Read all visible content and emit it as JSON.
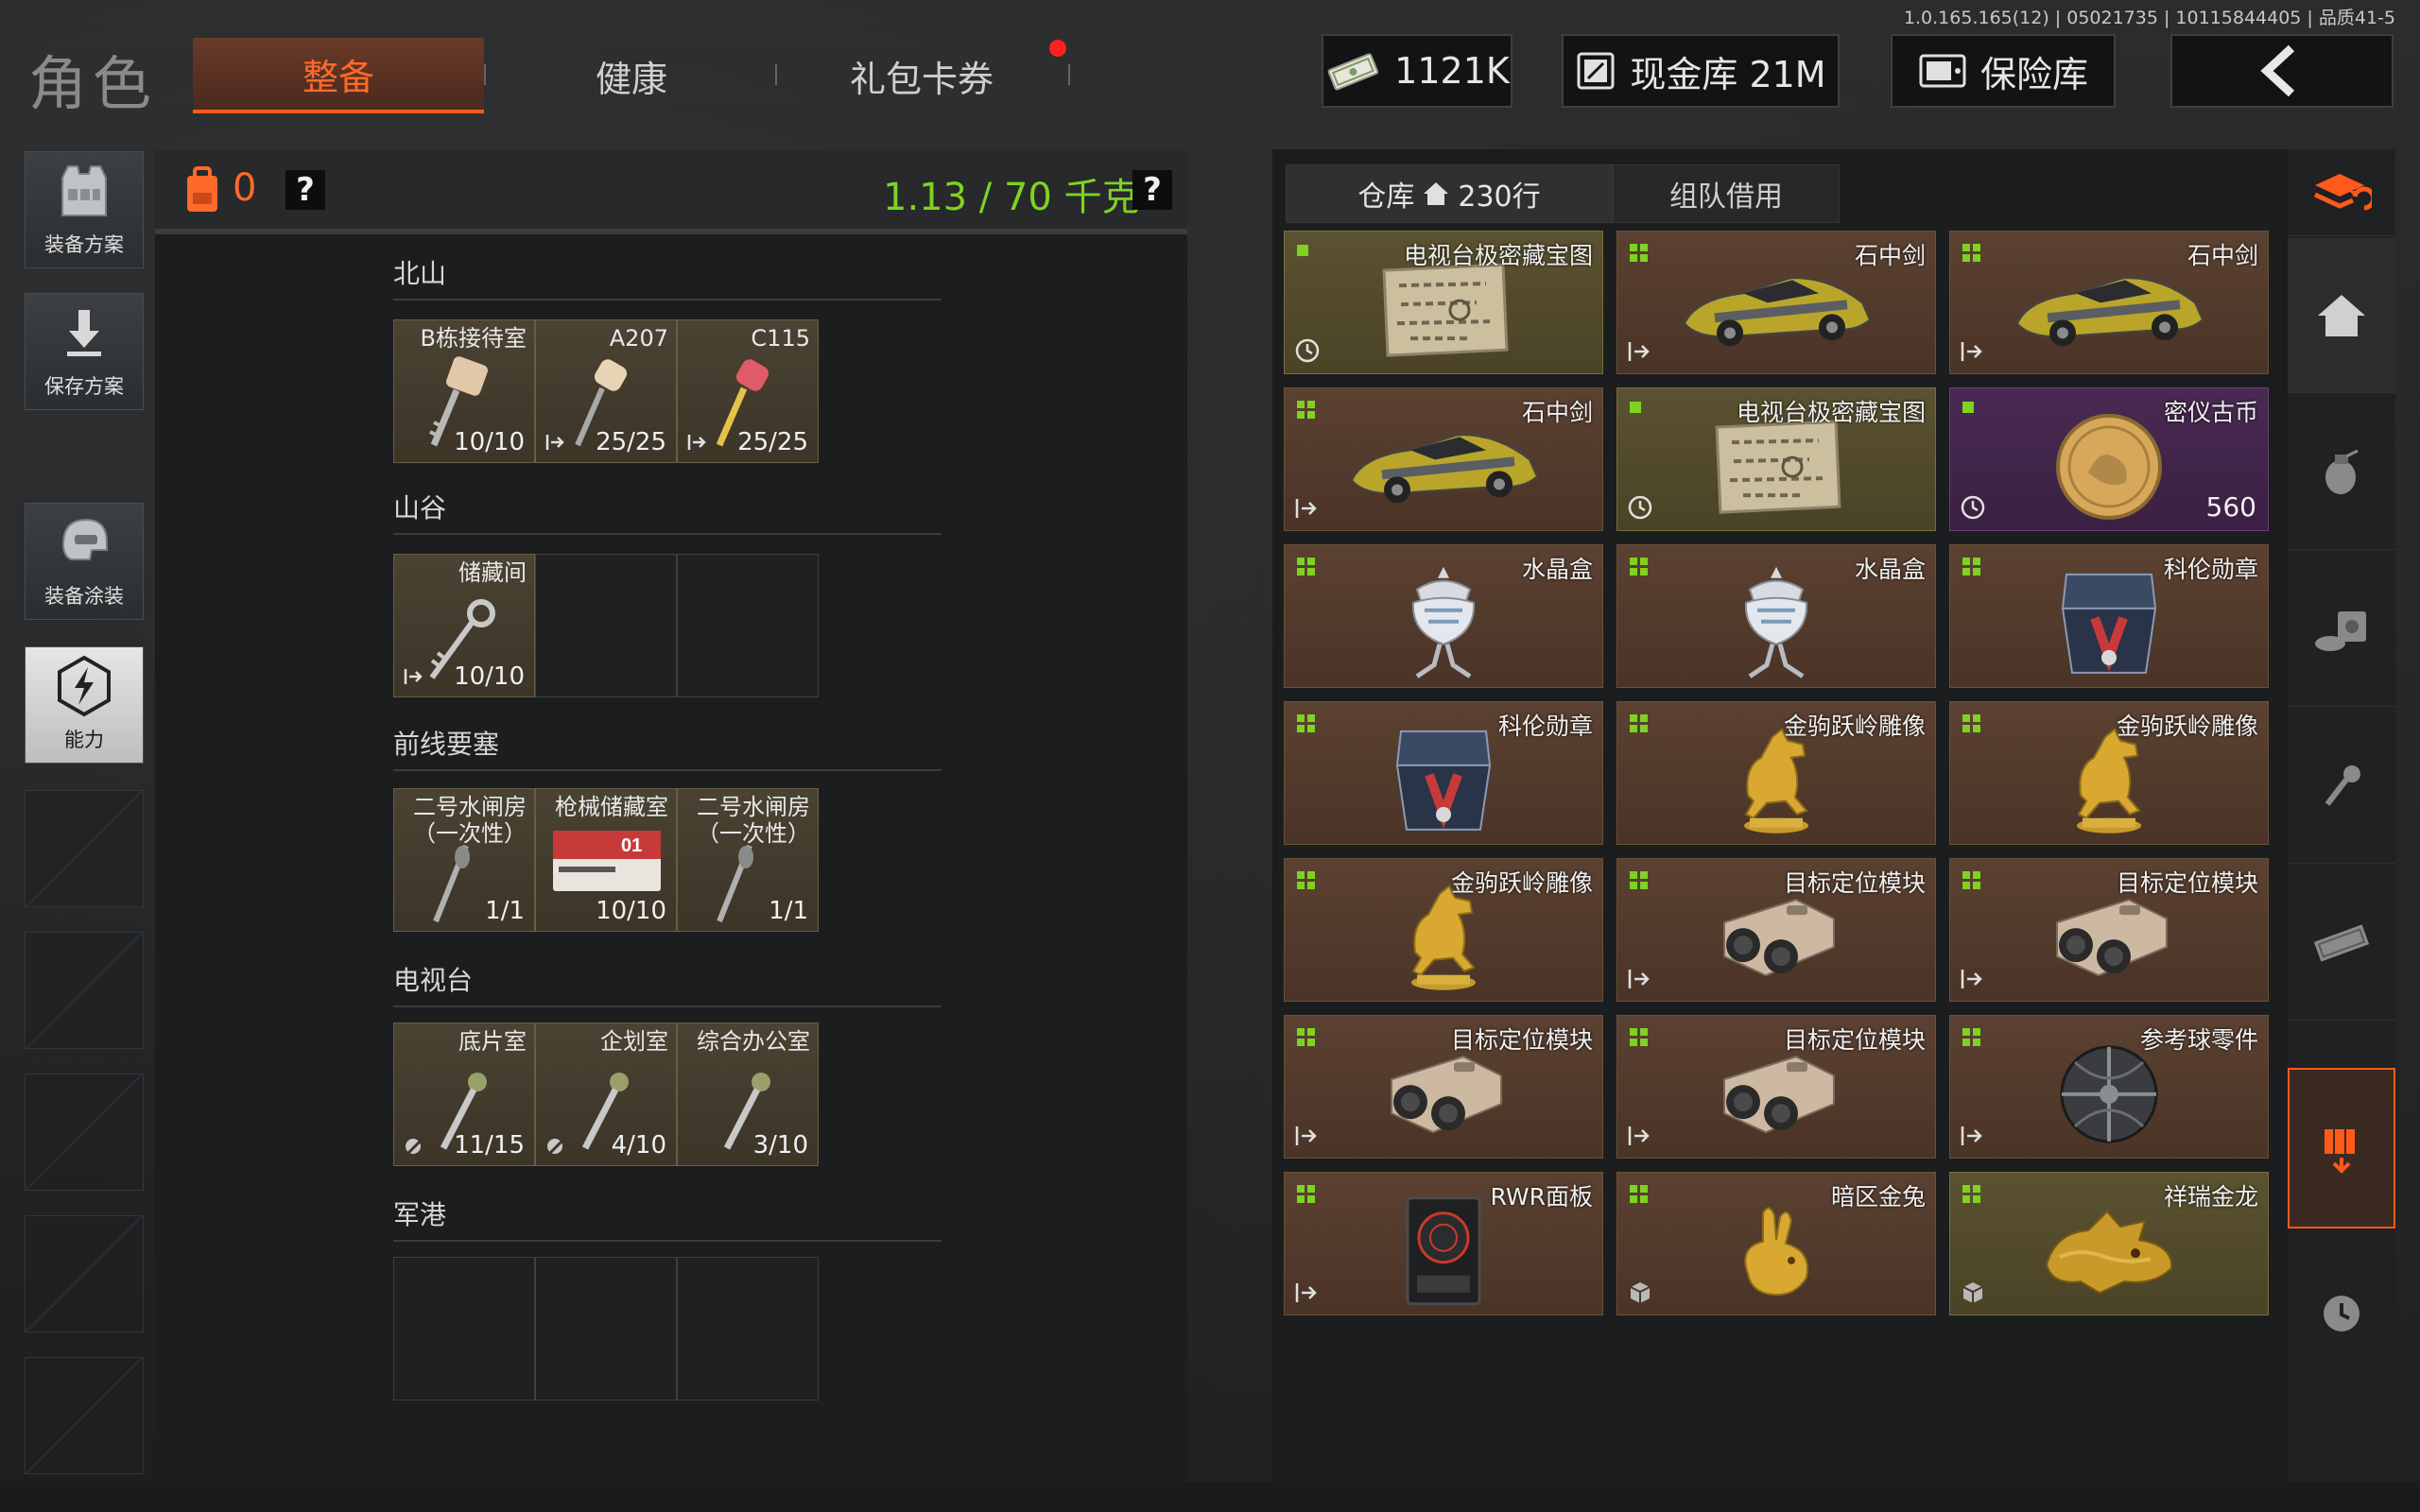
{
  "version": "1.0.165.165(12) | 05021735 | 10115844405 | 品质41-5",
  "header": {
    "title": "角色",
    "tabs": [
      {
        "label": "整备",
        "active": true
      },
      {
        "label": "健康",
        "active": false
      },
      {
        "label": "礼包卡券",
        "active": false,
        "notification": true
      }
    ],
    "currency": "1121K",
    "cash_vault": "现金库 21M",
    "safe": "保险库"
  },
  "sidebar": {
    "items": [
      {
        "label": "装备方案",
        "icon": "vest-icon"
      },
      {
        "label": "保存方案",
        "icon": "download-icon"
      },
      {
        "label": "装备涂装",
        "icon": "helmet-icon"
      },
      {
        "label": "能力",
        "icon": "ability-icon",
        "active": true
      }
    ]
  },
  "left_panel": {
    "bag_count": "0",
    "weight": "1.13 / 70 千克",
    "help": "?",
    "regions": [
      {
        "name": "北山",
        "keys": [
          {
            "name": "B栋接待室",
            "count": "10/10"
          },
          {
            "name": "A207",
            "count": "25/25"
          },
          {
            "name": "C115",
            "count": "25/25"
          }
        ]
      },
      {
        "name": "山谷",
        "keys": [
          {
            "name": "储藏间",
            "count": "10/10"
          }
        ]
      },
      {
        "name": "前线要塞",
        "keys": [
          {
            "name": "二号水闸房\n（一次性）",
            "count": "1/1"
          },
          {
            "name": "枪械储藏室",
            "count": "10/10"
          },
          {
            "name": "二号水闸房\n（一次性）",
            "count": "1/1"
          }
        ]
      },
      {
        "name": "电视台",
        "keys": [
          {
            "name": "底片室",
            "count": "11/15"
          },
          {
            "name": "企划室",
            "count": "4/10"
          },
          {
            "name": "综合办公室",
            "count": "3/10"
          }
        ]
      },
      {
        "name": "军港",
        "keys": []
      }
    ]
  },
  "warehouse": {
    "tabs": [
      {
        "label": "仓库",
        "sub": "230行",
        "active": true
      },
      {
        "label": "组队借用",
        "active": false
      }
    ],
    "items": [
      {
        "name": "电视台极密藏宝图",
        "type": "gold",
        "icon": "treasure-map-icon",
        "mark": "clock"
      },
      {
        "name": "石中剑",
        "type": "red",
        "icon": "sports-car-icon",
        "mark": "exit"
      },
      {
        "name": "石中剑",
        "type": "red",
        "icon": "sports-car-icon",
        "mark": "exit"
      },
      {
        "name": "石中剑",
        "type": "red",
        "icon": "sports-car-icon",
        "mark": "exit"
      },
      {
        "name": "电视台极密藏宝图",
        "type": "gold",
        "icon": "treasure-map-icon",
        "mark": "clock"
      },
      {
        "name": "密仪古币",
        "type": "purple",
        "icon": "coin-icon",
        "mark": "clock",
        "qty": "560"
      },
      {
        "name": "水晶盒",
        "type": "red",
        "icon": "crystal-box-icon"
      },
      {
        "name": "水晶盒",
        "type": "red",
        "icon": "crystal-box-icon"
      },
      {
        "name": "科伦勋章",
        "type": "red",
        "icon": "medal-box-icon"
      },
      {
        "name": "科伦勋章",
        "type": "red",
        "icon": "medal-box-icon"
      },
      {
        "name": "金驹跃岭雕像",
        "type": "red",
        "icon": "horse-statue-icon"
      },
      {
        "name": "金驹跃岭雕像",
        "type": "red",
        "icon": "horse-statue-icon"
      },
      {
        "name": "金驹跃岭雕像",
        "type": "red",
        "icon": "horse-statue-icon"
      },
      {
        "name": "目标定位模块",
        "type": "red",
        "icon": "targeting-module-icon",
        "mark": "exit"
      },
      {
        "name": "目标定位模块",
        "type": "red",
        "icon": "targeting-module-icon",
        "mark": "exit"
      },
      {
        "name": "目标定位模块",
        "type": "red",
        "icon": "targeting-module-icon",
        "mark": "exit"
      },
      {
        "name": "目标定位模块",
        "type": "red",
        "icon": "targeting-module-icon",
        "mark": "exit"
      },
      {
        "name": "参考球零件",
        "type": "red",
        "icon": "sphere-icon",
        "mark": "exit"
      },
      {
        "name": "RWR面板",
        "type": "red",
        "icon": "rwr-panel-icon",
        "mark": "exit"
      },
      {
        "name": "暗区金兔",
        "type": "red",
        "icon": "gold-rabbit-icon",
        "mark": "box"
      },
      {
        "name": "祥瑞金龙",
        "type": "gold",
        "icon": "gold-dragon-icon",
        "mark": "box"
      }
    ]
  },
  "colors": {
    "accent": "#ff5a1a",
    "weight": "#7ed321",
    "item_red": "#4a3427",
    "item_gold": "#4a4326",
    "item_purple": "#3a2042"
  }
}
